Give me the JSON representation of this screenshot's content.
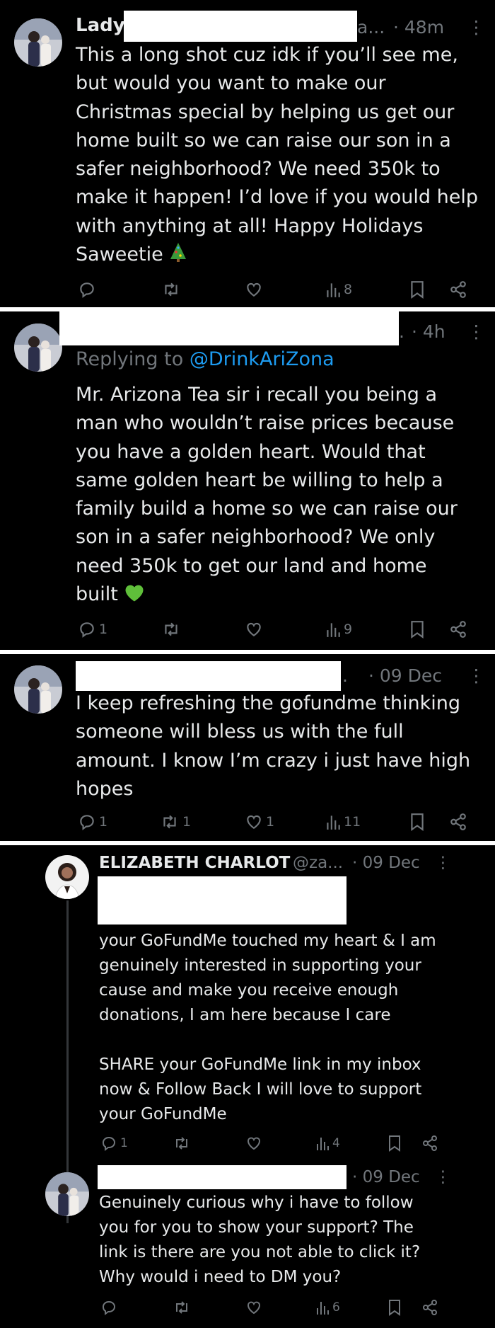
{
  "posts": [
    {
      "name": "Lady",
      "handle_fragment": "a...",
      "time": "· 48m",
      "text": "This a long shot cuz idk if you’ll see me,\nbut would you want to make our\nChristmas special by helping us get our\nhome built so we can raise our son in a\nsafer neighborhood? We need 350k to\nmake it happen! I’d love if you would help\nwith anything at all! Happy Holidays\nSaweetie",
      "emoji": "christmas-tree",
      "stats": {
        "replies": "",
        "reposts": "",
        "likes": "",
        "views": "8"
      }
    },
    {
      "name": "",
      "handle_fragment": ".",
      "time": "· 4h",
      "reply_prefix": "Replying to ",
      "reply_handle": "@DrinkAriZona",
      "text": "Mr. Arizona Tea sir i recall you being a\nman who wouldn’t raise prices because\nyou have a golden heart. Would that\nsame golden heart be willing to help a\nfamily build a home so we can raise our\nson in a safer neighborhood? We only\nneed 350k to get our land and home\nbuilt",
      "emoji": "green-heart",
      "stats": {
        "replies": "1",
        "reposts": "",
        "likes": "",
        "views": "9"
      }
    },
    {
      "name": "",
      "handle_fragment": ".",
      "time": "· 09 Dec",
      "text": "I keep refreshing the gofundme thinking\nsomeone will bless us with the full\namount. I know I’m crazy i just have high\nhopes",
      "stats": {
        "replies": "1",
        "reposts": "1",
        "likes": "1",
        "views": "11"
      }
    },
    {
      "name": "ELIZABETH CHARLOT",
      "handle": "@za...",
      "time": "· 09 Dec",
      "text": "your GoFundMe touched my heart & I am\ngenuinely interested in supporting your\ncause and make you receive enough\ndonations, I am here because I care\n\nSHARE your GoFundMe link in my inbox\nnow & Follow Back I will love to support\nyour GoFundMe",
      "stats": {
        "replies": "1",
        "reposts": "",
        "likes": "",
        "views": "4"
      }
    },
    {
      "name": "",
      "time": "· 09 Dec",
      "text": "Genuinely curious why i have to follow\nyou for you to show your support? The\nlink is there are you not able to click it?\nWhy would i need to DM you?",
      "stats": {
        "replies": "",
        "reposts": "",
        "likes": "",
        "views": "6"
      }
    }
  ],
  "colors": {
    "background": "#000000",
    "text": "#e7e9ea",
    "muted": "#71767b",
    "link": "#1d9bf0",
    "divider": "#ffffff"
  }
}
